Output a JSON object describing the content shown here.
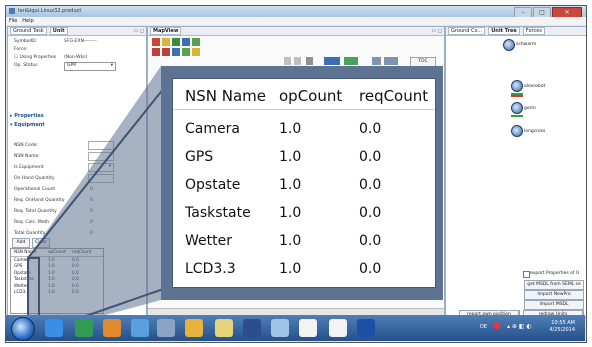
{
  "window": {
    "title": "Ieri&Iqui.Linux32.product",
    "buttons": [
      "–",
      "□",
      "✕"
    ]
  },
  "menu": [
    "File",
    "Help"
  ],
  "left_panel": {
    "tabs": [
      "Ground Task",
      "Unit"
    ],
    "properties": [
      {
        "label": "SymbolID:",
        "value": "SFG-EXN--------"
      },
      {
        "label": "Force:",
        "value": ""
      },
      {
        "label": "☐ Using Properties",
        "value": "(Non-Wks)"
      },
      {
        "label": "Op. Status",
        "value": "GPR"
      }
    ],
    "section_properties": "Properties",
    "section_equipment": "Equipment",
    "equipment_fields": [
      {
        "label": "NSN Code:",
        "value": ""
      },
      {
        "label": "NSN Name:",
        "value": ""
      },
      {
        "label": "Is Equipment",
        "value": ""
      },
      {
        "label": "On Hand Quantity",
        "value": ""
      },
      {
        "label": "Operational Count",
        "value": "0"
      },
      {
        "label": "Req. OnHand Quantity",
        "value": "0"
      },
      {
        "label": "Req. Total Quantity",
        "value": "0"
      },
      {
        "label": "Req. Calc. Meth.",
        "value": "0"
      },
      {
        "label": "Total Quantity",
        "value": "0"
      }
    ],
    "btn_add": "Add",
    "btn_clear": "Clear"
  },
  "small_table": {
    "headers": [
      "NSN Name",
      "opCount",
      "reqCount"
    ],
    "rows": [
      [
        "Camera",
        "1.0",
        "0.0"
      ],
      [
        "GPS",
        "1.0",
        "0.0"
      ],
      [
        "Opstate",
        "1.0",
        "0.0"
      ],
      [
        "Taskstate",
        "1.0",
        "0.0"
      ],
      [
        "Wetter",
        "1.0",
        "0.0"
      ],
      [
        "LCD3.3",
        "1.0",
        "0.0"
      ]
    ]
  },
  "map_panel": {
    "tab": "MapView",
    "toc_label": "TOC"
  },
  "right_panel": {
    "tabs": [
      "Ground Co...",
      "Unit Tree",
      "Forces"
    ],
    "tree_items": [
      "schwarm",
      "alexrobot",
      "gorm",
      "longcross"
    ],
    "checkbox_label": "export Properties of U",
    "buttons": [
      "get MSDL from SEML se",
      "Import NewPro",
      "Import MSDL",
      "Export CF",
      "Get Military Scenario",
      "report own position",
      "redraw Units"
    ]
  },
  "zoom_table": {
    "headers": [
      "NSN Name",
      "opCount",
      "reqCount"
    ],
    "rows": [
      [
        "Camera",
        "1.0",
        "0.0"
      ],
      [
        "GPS",
        "1.0",
        "0.0"
      ],
      [
        "Opstate",
        "1.0",
        "0.0"
      ],
      [
        "Taskstate",
        "1.0",
        "0.0"
      ],
      [
        "Wetter",
        "1.0",
        "0.0"
      ],
      [
        "LCD3.3",
        "1.0",
        "0.0"
      ]
    ]
  },
  "taskbar": {
    "tray_lang": "DE",
    "time": "10:55 AM",
    "date": "4/25/2014"
  }
}
